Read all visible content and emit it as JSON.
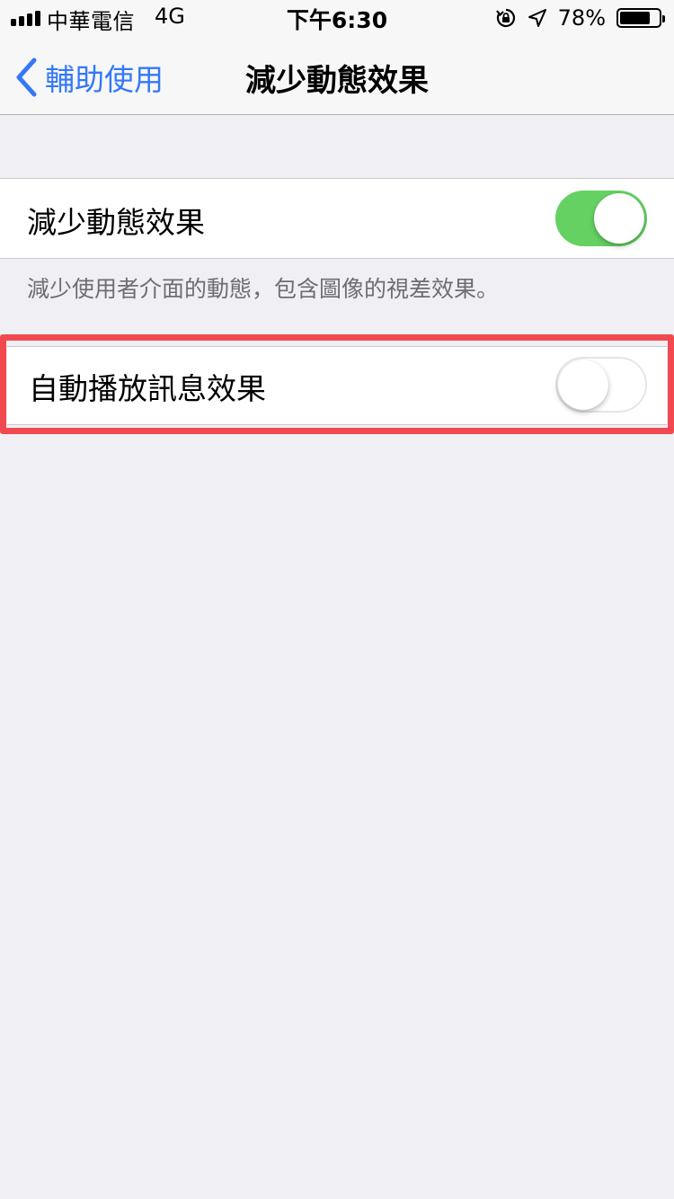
{
  "status_bar": {
    "carrier": "中華電信",
    "network": "4G",
    "time": "下午6:30",
    "battery_percent": "78%",
    "battery_level": 0.78,
    "icons": [
      "signal-bars-icon",
      "rotation-lock-icon",
      "location-arrow-icon",
      "battery-icon"
    ]
  },
  "nav": {
    "back_label": "輔助使用",
    "title": "減少動態效果"
  },
  "settings": {
    "reduce_motion": {
      "label": "減少動態效果",
      "enabled": true
    },
    "footer": "減少使用者介面的動態，包含圖像的視差效果。",
    "auto_play_message_effects": {
      "label": "自動播放訊息效果",
      "enabled": false
    }
  },
  "colors": {
    "accent": "#3478f6",
    "switch_on": "#64d162",
    "highlight": "#f2484f",
    "background": "#efeff4"
  }
}
